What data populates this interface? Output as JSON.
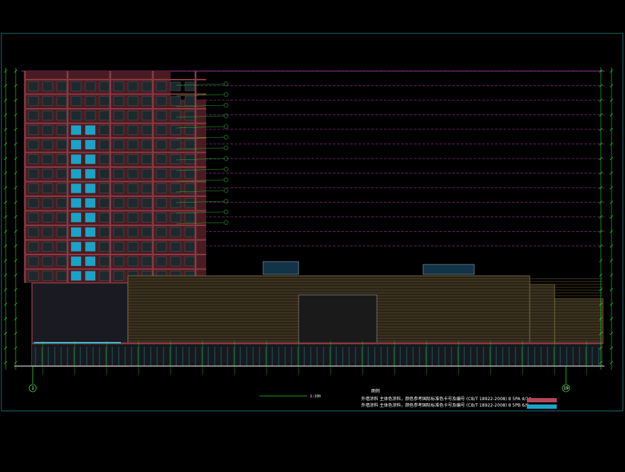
{
  "drawing": {
    "background": "#000000",
    "frame_color": "#1f6f6f",
    "grid_left": "1",
    "grid_right": "19",
    "notes_title": "图例",
    "note_lines": [
      "外墙涂料 主体色涂料，颜色参考国际标准色卡号及编号 (CB/T 18922-2008) 8 5PA 4/14",
      "外墙涂料 主体色涂料，颜色参考国际标准色卡号及编号 (CB/T 18922-2008) 8 5PB 6/9"
    ],
    "scale_title": "1:100",
    "legend_colors": [
      "#b5465a",
      "#1aa3c8"
    ],
    "colors": {
      "facade_red": "#8a3a44",
      "facade_dark": "#4a1c22",
      "window_blue": "#1aa3c8",
      "podium_brown": "#5a4a2a",
      "level_line": "#c040c0",
      "dimension_green": "#2ee02e",
      "ground_cyan": "#27c3d8"
    }
  }
}
